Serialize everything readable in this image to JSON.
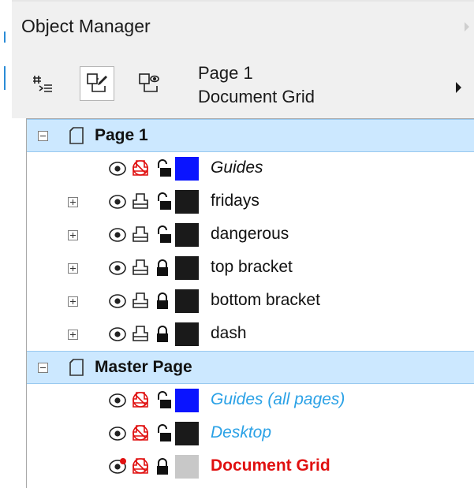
{
  "panel": {
    "title": "Object Manager"
  },
  "toolbar": {
    "page_name": "Page 1",
    "active_layer": "Document Grid",
    "buttons": [
      {
        "icon": "show-properties-icon"
      },
      {
        "icon": "edit-across-layers-icon",
        "active": true
      },
      {
        "icon": "layer-manager-view-icon"
      }
    ]
  },
  "tree": {
    "pages": [
      {
        "label": "Page 1",
        "expanded": true,
        "layers": [
          {
            "name": "Guides",
            "color": "#0a14ff",
            "style": "italic",
            "visible": true,
            "printable": false,
            "locked": false,
            "expandable": false
          },
          {
            "name": "fridays",
            "color": "#1a1a1a",
            "style": "normal",
            "visible": true,
            "printable": true,
            "locked": false,
            "expandable": true
          },
          {
            "name": "dangerous",
            "color": "#1a1a1a",
            "style": "normal",
            "visible": true,
            "printable": true,
            "locked": false,
            "expandable": true
          },
          {
            "name": "top bracket",
            "color": "#1a1a1a",
            "style": "normal",
            "visible": true,
            "printable": true,
            "locked": true,
            "expandable": true
          },
          {
            "name": "bottom bracket",
            "color": "#1a1a1a",
            "style": "normal",
            "visible": true,
            "printable": true,
            "locked": true,
            "expandable": true
          },
          {
            "name": "dash",
            "color": "#1a1a1a",
            "style": "normal",
            "visible": true,
            "printable": true,
            "locked": true,
            "expandable": true
          }
        ]
      },
      {
        "label": "Master Page",
        "expanded": true,
        "layers": [
          {
            "name": "Guides (all pages)",
            "color": "#0a14ff",
            "style": "italic-blue",
            "visible": true,
            "printable": false,
            "locked": false,
            "expandable": false
          },
          {
            "name": "Desktop",
            "color": "#1a1a1a",
            "style": "italic-blue",
            "visible": true,
            "printable": false,
            "locked": false,
            "expandable": false
          },
          {
            "name": "Document Grid",
            "color": "#c8c8c8",
            "style": "bold-red",
            "visible": true,
            "printable": false,
            "locked": true,
            "expandable": false
          }
        ]
      }
    ]
  }
}
